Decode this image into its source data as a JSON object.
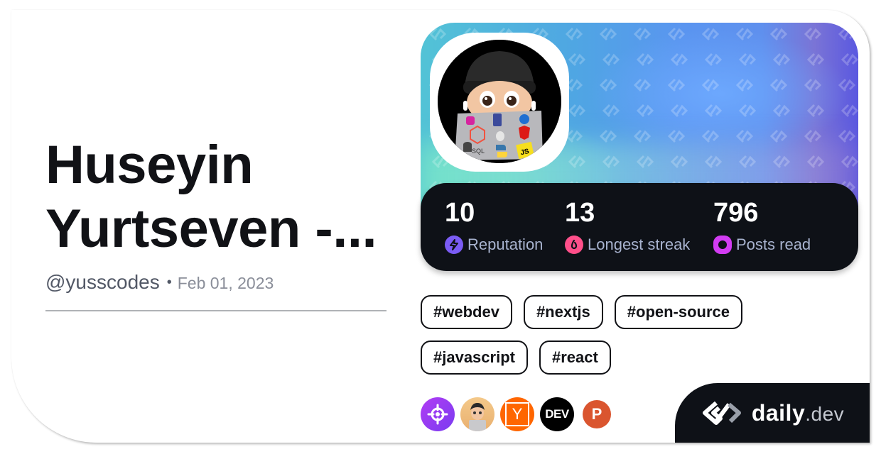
{
  "profile": {
    "name": "Huseyin Yurtseven -...",
    "handle": "@yusscodes",
    "separator": "•",
    "joined": "Feb 01, 2023",
    "avatar_icon": "memoji-avatar-laptop"
  },
  "stats": [
    {
      "value": "10",
      "label": "Reputation",
      "icon": "lightning-icon",
      "color": "#7b5cf5"
    },
    {
      "value": "13",
      "label": "Longest streak",
      "icon": "flame-icon",
      "color": "#ff4f8a"
    },
    {
      "value": "796",
      "label": "Posts read",
      "icon": "ring-icon",
      "color": "#d23cf2"
    }
  ],
  "tags": [
    "#webdev",
    "#nextjs",
    "#open-source",
    "#javascript",
    "#react"
  ],
  "sources": [
    {
      "name": "crosshair-source",
      "color": "#8f3cf4"
    },
    {
      "name": "devsquad-source",
      "color": "#e8b47a"
    },
    {
      "name": "hacker-news-source",
      "label": "Y",
      "color": "#ff6600"
    },
    {
      "name": "dev-to-source",
      "label": "DEV",
      "color": "#000000"
    },
    {
      "name": "product-hunt-source",
      "label": "P",
      "color": "#da552f"
    }
  ],
  "brand": {
    "name": "daily",
    "tld": ".dev"
  },
  "colors": {
    "ink": "#111216",
    "panel": "#0e1117",
    "label": "#a8b3cf"
  }
}
